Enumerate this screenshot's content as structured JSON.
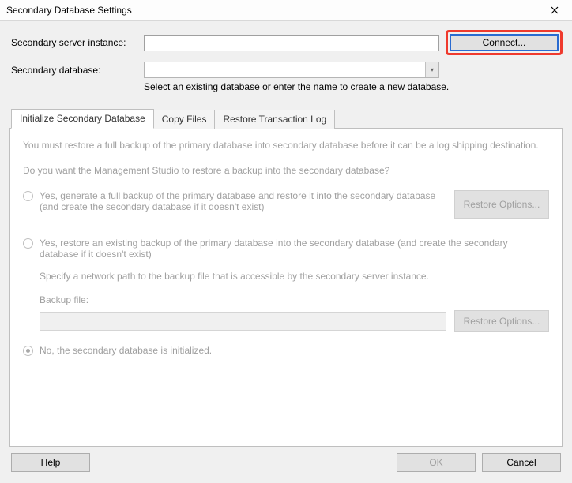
{
  "title": "Secondary Database Settings",
  "labels": {
    "server_instance": "Secondary server instance:",
    "secondary_database": "Secondary database:",
    "helper": "Select an existing database or enter the name to create a new database."
  },
  "fields": {
    "server_instance_value": "",
    "secondary_database_value": ""
  },
  "connect_button": "Connect...",
  "tabs": {
    "initialize": "Initialize Secondary Database",
    "copy": "Copy Files",
    "restore": "Restore Transaction Log"
  },
  "panel": {
    "intro": "You must restore a full backup of the primary database into secondary database before it can be a log shipping destination.",
    "question": "Do you want the Management Studio to restore a backup into the secondary database?",
    "opt1": "Yes, generate a full backup of the primary database and restore it into the secondary database (and create the secondary database if it doesn't exist)",
    "restore_options": "Restore Options...",
    "opt2": "Yes, restore an existing backup of the primary database into the secondary database (and create the secondary database if it doesn't exist)",
    "specify_path": "Specify a network path to the backup file that is accessible by the secondary server instance.",
    "backup_file_label": "Backup file:",
    "opt3": "No, the secondary database is initialized."
  },
  "buttons": {
    "help": "Help",
    "ok": "OK",
    "cancel": "Cancel"
  }
}
